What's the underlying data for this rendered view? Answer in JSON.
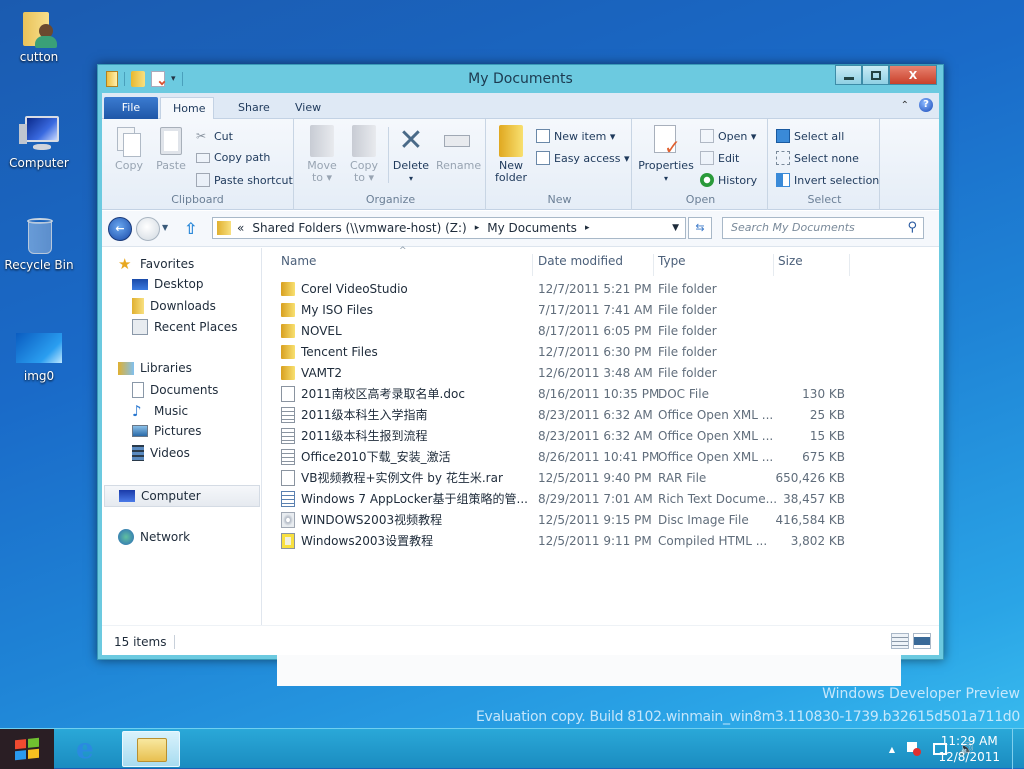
{
  "desktop": {
    "icons": [
      {
        "label": "cutton",
        "icon": "user-folder-icon"
      },
      {
        "label": "Computer",
        "icon": "computer-icon"
      },
      {
        "label": "Recycle Bin",
        "icon": "recycle-bin-icon"
      },
      {
        "label": "img0",
        "icon": "image-icon"
      }
    ],
    "watermark": {
      "line1": "Windows Developer Preview",
      "line2": "Evaluation copy. Build 8102.winmain_win8m3.110830-1739.b32615d501a711d0"
    }
  },
  "window": {
    "title": "My Documents",
    "controls": {
      "minimize": "—",
      "maximize": "▢",
      "close": "X"
    },
    "ribbon_tabs": [
      "File",
      "Home",
      "Share",
      "View"
    ],
    "active_tab": "Home",
    "ribbon": {
      "clipboard": {
        "label": "Clipboard",
        "copy": "Copy",
        "paste": "Paste",
        "cut": "Cut",
        "copy_path": "Copy path",
        "paste_shortcut": "Paste shortcut"
      },
      "organize": {
        "label": "Organize",
        "move_to": [
          "Move",
          "to ▾"
        ],
        "copy_to": [
          "Copy",
          "to ▾"
        ],
        "delete": "Delete",
        "rename": "Rename"
      },
      "new": {
        "label": "New",
        "new_folder": [
          "New",
          "folder"
        ],
        "new_item": "New item ▾",
        "easy_access": "Easy access ▾"
      },
      "open": {
        "label": "Open",
        "properties": "Properties",
        "open": "Open ▾",
        "edit": "Edit",
        "history": "History"
      },
      "select": {
        "label": "Select",
        "select_all": "Select all",
        "select_none": "Select none",
        "invert": "Invert selection"
      }
    },
    "address": {
      "prefix": "«",
      "crumbs": [
        "Shared Folders (\\\\vmware-host) (Z:)",
        "My Documents"
      ],
      "separator": "▸"
    },
    "search_placeholder": "Search My Documents",
    "nav": {
      "favorites": "Favorites",
      "favorites_items": [
        "Desktop",
        "Downloads",
        "Recent Places"
      ],
      "libraries": "Libraries",
      "libraries_items": [
        "Documents",
        "Music",
        "Pictures",
        "Videos"
      ],
      "computer": "Computer",
      "network": "Network"
    },
    "columns": [
      "Name",
      "Date modified",
      "Type",
      "Size"
    ],
    "files": [
      {
        "name": "Corel VideoStudio",
        "date": "12/7/2011 5:21 PM",
        "type": "File folder",
        "size": "",
        "kind": "folder"
      },
      {
        "name": "My ISO Files",
        "date": "7/17/2011 7:41 AM",
        "type": "File folder",
        "size": "",
        "kind": "folder"
      },
      {
        "name": "NOVEL",
        "date": "8/17/2011 6:05 PM",
        "type": "File folder",
        "size": "",
        "kind": "folder"
      },
      {
        "name": "Tencent Files",
        "date": "12/7/2011 6:30 PM",
        "type": "File folder",
        "size": "",
        "kind": "folder"
      },
      {
        "name": "VAMT2",
        "date": "12/6/2011 3:48 AM",
        "type": "File folder",
        "size": "",
        "kind": "folder"
      },
      {
        "name": "2011南校区高考录取名单.doc",
        "date": "8/16/2011 10:35 PM",
        "type": "DOC File",
        "size": "130 KB",
        "kind": "file"
      },
      {
        "name": "2011级本科生入学指南",
        "date": "8/23/2011 6:32 AM",
        "type": "Office Open XML ...",
        "size": "25 KB",
        "kind": "doc"
      },
      {
        "name": "2011级本科生报到流程",
        "date": "8/23/2011 6:32 AM",
        "type": "Office Open XML ...",
        "size": "15 KB",
        "kind": "doc"
      },
      {
        "name": "Office2010下载_安装_激活",
        "date": "8/26/2011 10:41 PM",
        "type": "Office Open XML ...",
        "size": "675 KB",
        "kind": "doc"
      },
      {
        "name": "VB视频教程+实例文件  by   花生米.rar",
        "date": "12/5/2011 9:40 PM",
        "type": "RAR File",
        "size": "650,426 KB",
        "kind": "file"
      },
      {
        "name": "Windows 7 AppLocker基于组策略的管...",
        "date": "8/29/2011 7:01 AM",
        "type": "Rich Text Docume...",
        "size": "38,457 KB",
        "kind": "rtf"
      },
      {
        "name": "WINDOWS2003视频教程",
        "date": "12/5/2011 9:15 PM",
        "type": "Disc Image File",
        "size": "416,584 KB",
        "kind": "disc"
      },
      {
        "name": "Windows2003设置教程",
        "date": "12/5/2011 9:11 PM",
        "type": "Compiled HTML ...",
        "size": "3,802 KB",
        "kind": "chm"
      }
    ],
    "status": "15 items"
  },
  "taskbar": {
    "time": "11:29 AM",
    "date": "12/8/2011",
    "tray_expand": "▲",
    "volume": "🔊"
  },
  "colors": {
    "accent": "#6ccae0",
    "file_tab": "#2a66bb",
    "close": "#c8402a"
  }
}
